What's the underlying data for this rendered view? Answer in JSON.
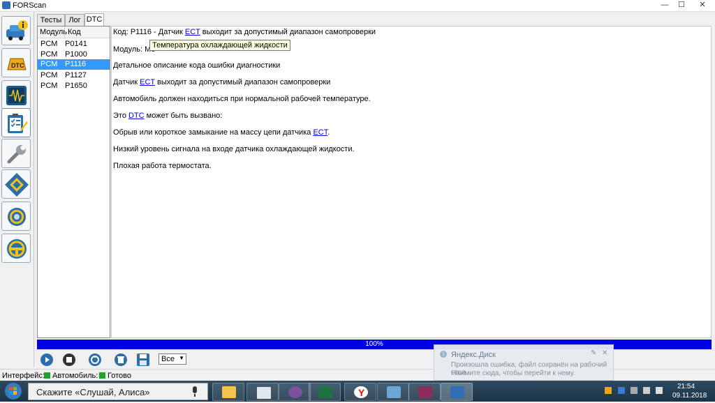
{
  "window": {
    "title": "FORScan",
    "minimize_glyph": "—",
    "maximize_glyph": "☐",
    "close_glyph": "✕"
  },
  "sidebar": {
    "items": [
      {
        "icon": "car-info-icon"
      },
      {
        "icon": "dtc-icon"
      },
      {
        "icon": "oscilloscope-icon"
      },
      {
        "icon": "checklist-icon",
        "active": true
      },
      {
        "icon": "wrench-icon"
      },
      {
        "icon": "chip-icon"
      },
      {
        "icon": "gear-icon"
      },
      {
        "icon": "help-icon"
      }
    ]
  },
  "tabs": [
    {
      "label": "Тесты"
    },
    {
      "label": "Лог"
    },
    {
      "label": "DTC",
      "active": true
    }
  ],
  "dtc_table": {
    "headers": [
      "Модуль",
      "Код"
    ],
    "rows": [
      {
        "module": "PCM",
        "code": "P0141",
        "selected": false
      },
      {
        "module": "PCM",
        "code": "P1000",
        "selected": false
      },
      {
        "module": "PCM",
        "code": "P1116",
        "selected": true
      },
      {
        "module": "PCM",
        "code": "P1127",
        "selected": false
      },
      {
        "module": "PCM",
        "code": "P1650",
        "selected": false
      }
    ]
  },
  "detail": {
    "line1_prefix": "Код: P1116 - Датчик ",
    "line1_link": "ECT",
    "line1_suffix": " выходит за допустимый диапазон самопроверки",
    "line2": "Модуль: Мо",
    "line3": "Детальное описание кода ошибки диагностики",
    "line4_prefix": "Датчик ",
    "line4_link": "ECT",
    "line4_suffix": " выходит за допустимый диапазон самопроверки",
    "line5": "Автомобиль должен находиться при нормальной рабочей температуре.",
    "line6_prefix": "Это ",
    "line6_link": "DTC",
    "line6_suffix": " может быть вызвано:",
    "line7_prefix": "Обрыв или короткое замыкание на массу цепи датчика ",
    "line7_link": "ECT",
    "line7_suffix": ".",
    "line8": "Низкий уровень сигнала на входе датчика охлаждающей жидкости.",
    "line9": "Плохая работа термостата."
  },
  "tooltip": "Температура охлаждающей жидкости",
  "progress": {
    "label": "100%",
    "value": 1.0
  },
  "toolbar": {
    "buttons": [
      "play-icon",
      "stop-icon",
      "scan-icon",
      "clear-icon",
      "save-icon"
    ],
    "filter_value": "Все"
  },
  "statusbar": {
    "interface_label": "Интерфейс:",
    "vehicle_label": "Автомобиль:",
    "ready_label": "Готово",
    "indicator_color": "#1fa32a"
  },
  "notification": {
    "title": "Яндекс.Диск",
    "body1": "Произошла ошибка, файл сохранён на рабочий стол.",
    "body2": "Нажмите сюда, чтобы перейти к нему.",
    "close_glyph": "✕",
    "pin_glyph": "✎"
  },
  "taskbar": {
    "search_placeholder": "Скажите «Слушай, Алиса»",
    "apps": [
      {
        "icon": "file-explorer-icon"
      },
      {
        "icon": "window-app-icon"
      },
      {
        "icon": "viber-icon"
      },
      {
        "icon": "excel-icon"
      },
      {
        "icon": "yandex-browser-icon"
      },
      {
        "icon": "network-app-icon"
      },
      {
        "icon": "winrar-icon"
      },
      {
        "icon": "forscan-taskbar-icon"
      }
    ],
    "clock_time": "21:54",
    "clock_date": "09.11.2018"
  }
}
